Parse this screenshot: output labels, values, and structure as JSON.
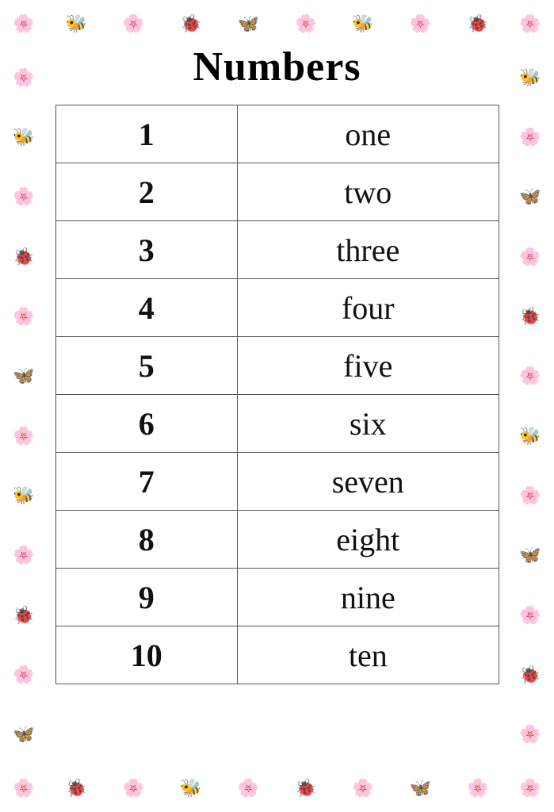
{
  "page": {
    "title": "Numbers",
    "background_color": "#ffffff"
  },
  "table": {
    "rows": [
      {
        "number": "1",
        "word": "one"
      },
      {
        "number": "2",
        "word": "two"
      },
      {
        "number": "3",
        "word": "three"
      },
      {
        "number": "4",
        "word": "four"
      },
      {
        "number": "5",
        "word": "five"
      },
      {
        "number": "6",
        "word": "six"
      },
      {
        "number": "7",
        "word": "seven"
      },
      {
        "number": "8",
        "word": "eight"
      },
      {
        "number": "9",
        "word": "nine"
      },
      {
        "number": "10",
        "word": "ten"
      }
    ]
  },
  "border": {
    "top_icons": [
      "🐝",
      "🌸",
      "🐞",
      "🦋",
      "🌸",
      "🐝",
      "🌸",
      "🐞"
    ],
    "bottom_icons": [
      "🐞",
      "🌸",
      "🐝",
      "🌸",
      "🐞",
      "🌸",
      "🦋",
      "🌸"
    ],
    "left_icons": [
      "🌸",
      "🐝",
      "🌸",
      "🐞",
      "🌸",
      "🦋",
      "🌸",
      "🐝",
      "🌸",
      "🐞",
      "🌸",
      "🦋"
    ],
    "right_icons": [
      "🐝",
      "🌸",
      "🦋",
      "🌸",
      "🐞",
      "🌸",
      "🐝",
      "🌸",
      "🦋",
      "🌸",
      "🐞",
      "🌸"
    ],
    "corner_icons": [
      "🌸",
      "🌸",
      "🌸",
      "🌸"
    ]
  }
}
